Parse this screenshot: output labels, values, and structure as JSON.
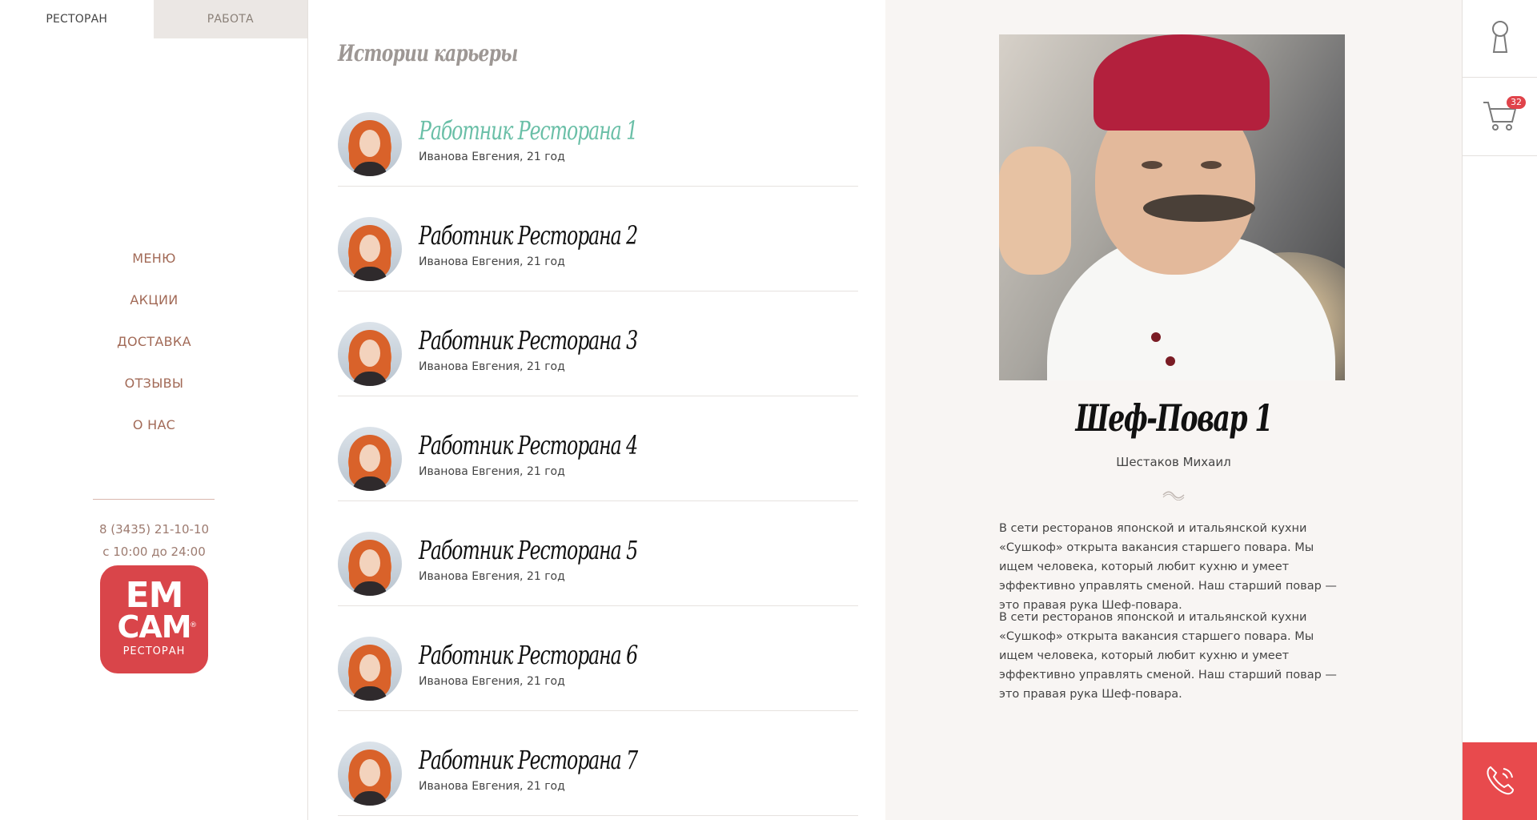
{
  "tabs": [
    {
      "label": "РЕСТОРАН",
      "active": true
    },
    {
      "label": "РАБОТА",
      "active": false
    }
  ],
  "nav": [
    "МЕНЮ",
    "АКЦИИ",
    "ДОСТАВКА",
    "ОТЗЫВЫ",
    "О НАС"
  ],
  "contacts": {
    "phone": "8 (3435) 21-10-10",
    "hours": "с 10:00 до 24:00"
  },
  "logo": {
    "line1": "EM",
    "line2": "CAM",
    "line3": "РЕСТОРАН",
    "mark": "®"
  },
  "stories": {
    "title": "Истории карьеры",
    "items": [
      {
        "title": "Работник Ресторана 1",
        "subtitle": "Иванова Евгения, 21 год",
        "active": true
      },
      {
        "title": "Работник Ресторана 2",
        "subtitle": "Иванова Евгения, 21 год",
        "active": false
      },
      {
        "title": "Работник Ресторана 3",
        "subtitle": "Иванова Евгения, 21 год",
        "active": false
      },
      {
        "title": "Работник Ресторана 4",
        "subtitle": "Иванова Евгения, 21 год",
        "active": false
      },
      {
        "title": "Работник Ресторана 5",
        "subtitle": "Иванова Евгения, 21 год",
        "active": false
      },
      {
        "title": "Работник Ресторана 6",
        "subtitle": "Иванова Евгения, 21 год",
        "active": false
      },
      {
        "title": "Работник Ресторана 7",
        "subtitle": "Иванова Евгения, 21 год",
        "active": false
      }
    ]
  },
  "detail": {
    "title": "Шеф-Повар 1",
    "name": "Шестаков Михаил",
    "paragraphs": [
      "В сети ресторанов японской и итальянской кухни «Сушкоф» открыта вакансия старшего повара. Мы ищем человека, который любит кухню и умеет эффективно управлять сменой. Наш старший повар — это правая рука Шеф-повара.",
      "В сети ресторанов японской и итальянской кухни «Сушкоф» открыта вакансия старшего повара. Мы ищем человека, который любит кухню и умеет эффективно управлять сменой. Наш старший повар — это правая рука Шеф-повара."
    ]
  },
  "utility": {
    "account_icon": "keyhole-icon",
    "cart_icon": "cart-icon",
    "cart_count": "32",
    "call_icon": "phone-icon"
  },
  "colors": {
    "accent": "#e84a4d",
    "active_link": "#6abfa7",
    "nav_text": "#a26a57"
  }
}
